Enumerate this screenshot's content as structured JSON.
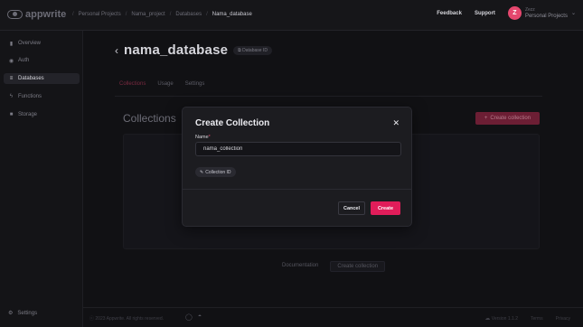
{
  "brand": {
    "name": "appwrite"
  },
  "breadcrumbs": [
    "Personal Projects",
    "Nama_project",
    "Databases",
    "Nama_database"
  ],
  "topbar": {
    "feedback_label": "Feedback",
    "support_label": "Support",
    "avatar_initial": "Z",
    "account_user": "Zezz",
    "account_org": "Personal Projects"
  },
  "sidebar": {
    "items": [
      {
        "label": "Overview",
        "icon": "chart-icon"
      },
      {
        "label": "Auth",
        "icon": "users-icon"
      },
      {
        "label": "Databases",
        "icon": "database-icon",
        "active": true
      },
      {
        "label": "Functions",
        "icon": "lightning-icon"
      },
      {
        "label": "Storage",
        "icon": "folder-icon"
      }
    ],
    "settings_label": "Settings"
  },
  "database": {
    "title": "nama_database",
    "id_badge": "Database ID"
  },
  "tabs": [
    {
      "label": "Collections",
      "active": true
    },
    {
      "label": "Usage"
    },
    {
      "label": "Settings"
    }
  ],
  "collections": {
    "heading": "Collections",
    "create_label": "Create collection",
    "documentation_link": "Documentation",
    "create_link": "Create collection"
  },
  "footer": {
    "copyright": "ⓒ 2023 Appwrite. All rights reserved.",
    "version": "Version 1.1.2",
    "terms": "Terms",
    "privacy": "Privacy"
  },
  "modal": {
    "title": "Create Collection",
    "name_label": "Name",
    "name_required_mark": "*",
    "name_value": "nama_collection",
    "collection_id_label": "Collection ID",
    "cancel_label": "Cancel",
    "create_label": "Create"
  },
  "colors": {
    "accent": "#e11d5a",
    "background": "#111114",
    "modal": "#1c1c20"
  }
}
